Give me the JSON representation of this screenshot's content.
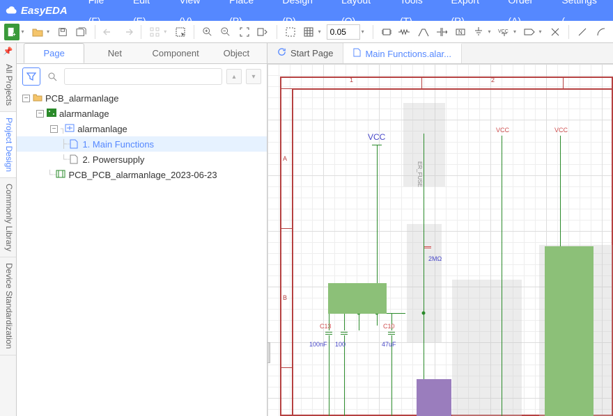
{
  "app": {
    "name": "EasyEDA"
  },
  "menu": {
    "file": "File (F)",
    "edit": "Edit (E)",
    "view": "View (V)",
    "place": "Place (P)",
    "design": "Design (D)",
    "layout": "Layout (O)",
    "tools": "Tools (T)",
    "export": "Export (R)",
    "order": "Order (A)",
    "settings": "Settings ("
  },
  "toolbar": {
    "grid_value": "0.05"
  },
  "rail": {
    "all_projects": "All Projects",
    "project_design": "Project Design",
    "commonly_library": "Commonly Library",
    "device_standardization": "Device Standardization"
  },
  "side_tabs": {
    "page": "Page",
    "net": "Net",
    "component": "Component",
    "object": "Object"
  },
  "search": {
    "placeholder": ""
  },
  "tree": {
    "root": "PCB_alarmanlage",
    "child1": "alarmanlage",
    "child2": "alarmanlage",
    "leaf1": "1. Main Functions",
    "leaf2": "2. Powersupply",
    "sibling": "PCB_PCB_alarmanlage_2023-06-23"
  },
  "doc_tabs": {
    "start": "Start Page",
    "main": "Main Functions.alar..."
  },
  "schematic": {
    "ruler_1": "1",
    "ruler_2": "2",
    "side_A": "A",
    "side_B": "B",
    "vcc": "VCC",
    "vcc2": "VCC",
    "vcc3": "VCC",
    "after_fuse": "ER_FUSE",
    "c13": "C13",
    "c10": "C10",
    "v100n": "100nF",
    "v100n2": "100",
    "v47u": "47uF",
    "r2m": "2MΩ"
  }
}
